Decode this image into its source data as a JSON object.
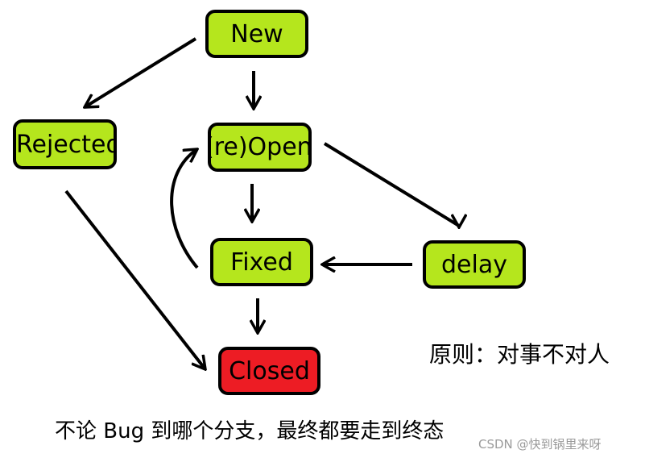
{
  "nodes": {
    "new": "New",
    "rejected": "Rejected",
    "open": "(re)Open",
    "fixed": "Fixed",
    "delay": "delay",
    "closed": "Closed"
  },
  "colors": {
    "state": "#b5e61d",
    "closed": "#ed1c24",
    "line": "#000000"
  },
  "principle": "原则：对事不对人",
  "caption": "不论 Bug 到哪个分支，最终都要走到终态",
  "watermark": "CSDN @快到锅里来呀"
}
